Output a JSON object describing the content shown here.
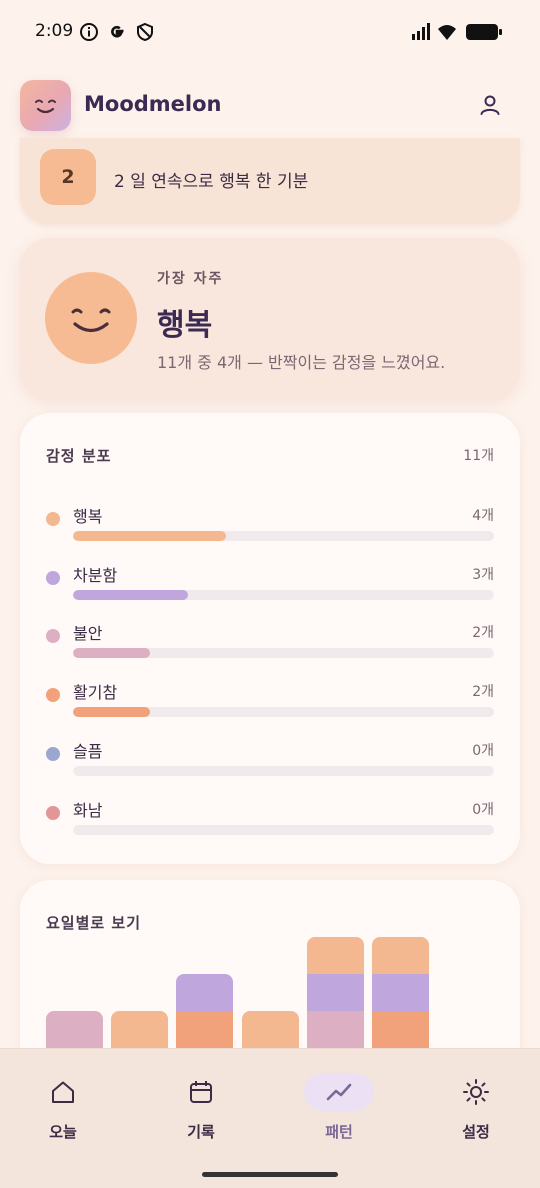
{
  "status_bar": {
    "time": "2:09",
    "icons": [
      "info-icon",
      "google-icon",
      "shield-icon",
      "signal-icon",
      "wifi-icon",
      "battery-icon"
    ]
  },
  "header": {
    "app_name": "Moodmelon",
    "logo_icon": "smiley-logo-icon",
    "profile_icon": "user-icon"
  },
  "streak": {
    "count": "2",
    "text": "2 일 연속으로 행복 한 기분"
  },
  "hero": {
    "caption": "가장 자주",
    "mood": "행복",
    "description": "11개 중 4개 — 반짝이는 감정을 느꼈어요.",
    "face_color": "#f6bb93"
  },
  "distribution": {
    "title": "감정 분포",
    "total": "11개",
    "total_value": 11,
    "items": [
      {
        "label": "행복",
        "value_text": "4개",
        "value": 4,
        "color": "#f3b88f"
      },
      {
        "label": "차분함",
        "value_text": "3개",
        "value": 3,
        "color": "#bfa6dc"
      },
      {
        "label": "불안",
        "value_text": "2개",
        "value": 2,
        "color": "#dcafc3"
      },
      {
        "label": "활기참",
        "value_text": "2개",
        "value": 2,
        "color": "#f2a27a"
      },
      {
        "label": "슬픔",
        "value_text": "0개",
        "value": 0,
        "color": "#9aa8d0"
      },
      {
        "label": "화남",
        "value_text": "0개",
        "value": 0,
        "color": "#e39696"
      }
    ]
  },
  "weekday": {
    "title": "요일별로 보기"
  },
  "chart_data": {
    "type": "bar",
    "stacked": true,
    "categories": [
      "",
      "",
      "",
      "",
      "",
      ""
    ],
    "series": [
      {
        "color": "#f2a27a",
        "values": [
          0,
          0,
          1,
          0,
          0,
          1
        ]
      },
      {
        "color": "#dcafc3",
        "values": [
          1,
          0,
          0,
          0,
          1,
          0
        ]
      },
      {
        "color": "#f3b88f",
        "values": [
          0,
          1,
          0,
          1,
          0,
          0
        ]
      },
      {
        "color": "#bfa6dc",
        "values": [
          0,
          0,
          1,
          0,
          1,
          1
        ]
      },
      {
        "color": "#f3b88f",
        "values": [
          0,
          0,
          0,
          0,
          1,
          1
        ]
      }
    ],
    "note_visible": "chart is cropped by bottom navigation",
    "title": "",
    "xlabel": "",
    "ylabel": ""
  },
  "nav": {
    "items": [
      {
        "label": "오늘",
        "icon": "home-icon",
        "active": false
      },
      {
        "label": "기록",
        "icon": "calendar-icon",
        "active": false
      },
      {
        "label": "패턴",
        "icon": "trend-icon",
        "active": true
      },
      {
        "label": "설정",
        "icon": "sun-settings-icon",
        "active": false
      }
    ]
  }
}
